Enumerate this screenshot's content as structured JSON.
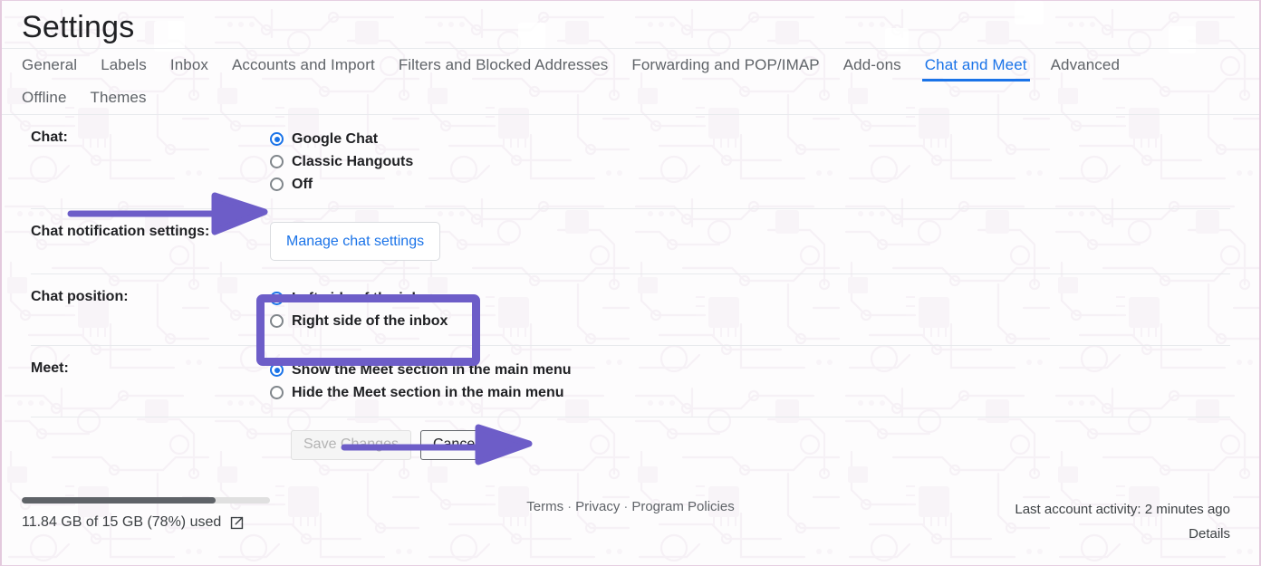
{
  "header": {
    "title": "Settings"
  },
  "tabs_row1": [
    {
      "label": "General",
      "active": false
    },
    {
      "label": "Labels",
      "active": false
    },
    {
      "label": "Inbox",
      "active": false
    },
    {
      "label": "Accounts and Import",
      "active": false
    },
    {
      "label": "Filters and Blocked Addresses",
      "active": false
    },
    {
      "label": "Forwarding and POP/IMAP",
      "active": false
    },
    {
      "label": "Add-ons",
      "active": false
    },
    {
      "label": "Chat and Meet",
      "active": true
    },
    {
      "label": "Advanced",
      "active": false
    }
  ],
  "tabs_row2": [
    {
      "label": "Offline",
      "active": false
    },
    {
      "label": "Themes",
      "active": false
    }
  ],
  "rows": {
    "chat": {
      "label": "Chat:",
      "options": [
        {
          "label": "Google Chat",
          "checked": true
        },
        {
          "label": "Classic Hangouts",
          "checked": false
        },
        {
          "label": "Off",
          "checked": false
        }
      ]
    },
    "chat_notification": {
      "label": "Chat notification settings:",
      "button_label": "Manage chat settings"
    },
    "chat_position": {
      "label": "Chat position:",
      "options": [
        {
          "label": "Left side of the inbox",
          "checked": true
        },
        {
          "label": "Right side of the inbox",
          "checked": false
        }
      ]
    },
    "meet": {
      "label": "Meet:",
      "options": [
        {
          "label": "Show the Meet section in the main menu",
          "checked": true
        },
        {
          "label": "Hide the Meet section in the main menu",
          "checked": false
        }
      ]
    }
  },
  "actions": {
    "save_label": "Save Changes",
    "save_disabled": true,
    "cancel_label": "Cancel"
  },
  "footer": {
    "storage_text": "11.84 GB of 15 GB (78%) used",
    "storage_percent": 78,
    "links": [
      {
        "label": "Terms"
      },
      {
        "label": "Privacy"
      },
      {
        "label": "Program Policies"
      }
    ],
    "link_separator": "·",
    "activity_text": "Last account activity: 2 minutes ago",
    "details_label": "Details",
    "external_link_icon": "external-link-icon"
  },
  "annotations": {
    "arrow_color": "#6d5dc8",
    "highlight_color": "#6d5dc8",
    "arrow_chat_off": "arrow-pointing-to-off-radio",
    "arrow_save": "arrow-pointing-to-save-changes",
    "highlight_chat_position": "highlight-box-chat-position"
  },
  "colors": {
    "accent_blue": "#1a73e8",
    "text_primary": "#202124",
    "text_secondary": "#5f6368",
    "divider": "#e8eaed",
    "page_border": "#e3c9dd"
  }
}
